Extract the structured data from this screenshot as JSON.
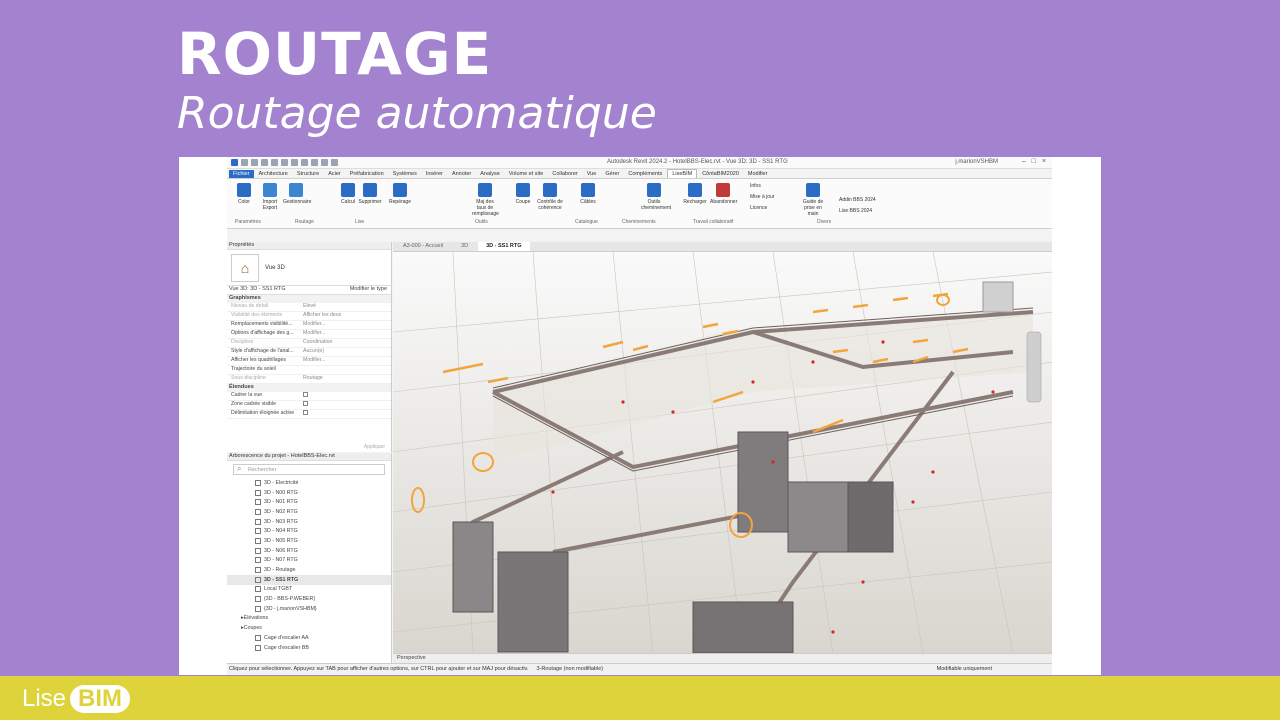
{
  "slide": {
    "title": "ROUTAGE",
    "subtitle": "Routage automatique",
    "brand_lise": "Lise",
    "brand_bim": "BIM"
  },
  "colors": {
    "background": "#a383cf",
    "footer": "#ded33b",
    "accent": "#2b6cc4",
    "routing": "#f4a43a"
  },
  "titlebar": {
    "title": "Autodesk Revit 2024.2 - HotelBBS-Elec.rvt - Vue 3D: 3D - SS1 RTG",
    "user": "j.marionVSHBM"
  },
  "tabs": [
    "Fichier",
    "Architecture",
    "Structure",
    "Acier",
    "Préfabrication",
    "Systèmes",
    "Insérer",
    "Annoter",
    "Analyse",
    "Volume et site",
    "Collaborer",
    "Vue",
    "Gérer",
    "Compléments",
    "LiseBIM",
    "CôntaBIM2020",
    "Modifier"
  ],
  "ribbon": {
    "buttons": [
      {
        "label": "Color",
        "icon": "color-icon"
      },
      {
        "label": "Import Export",
        "icon": "import-export-icon"
      },
      {
        "label": "Gestionnaire",
        "icon": "manager-icon"
      },
      {
        "label": "Calcul",
        "icon": "calc-icon"
      },
      {
        "label": "Supprimer",
        "icon": "delete-icon"
      },
      {
        "label": "Repérage",
        "icon": "marking-icon"
      },
      {
        "label": "Maj des taux de remplissage",
        "icon": "fill-rate-icon"
      },
      {
        "label": "Coupe",
        "icon": "section-icon"
      },
      {
        "label": "Contrôle de cohérence",
        "icon": "coherence-icon"
      },
      {
        "label": "Câbles",
        "icon": "cables-icon"
      },
      {
        "label": "Outils cheminement",
        "icon": "routing-tools-icon"
      },
      {
        "label": "Recharger",
        "icon": "reload-icon"
      },
      {
        "label": "Abandonner",
        "icon": "abandon-icon"
      },
      {
        "label": "Guide de prise en main",
        "icon": "guide-icon"
      }
    ],
    "small": [
      "Infos",
      "Mise à jour",
      "Licence",
      "Addin BBS 2024",
      "Lise BBS 2024"
    ],
    "groups": [
      "Paramètres",
      "Routage",
      "Lise",
      "Outils",
      "Catalogue",
      "Cheminements",
      "Travail collaboratif",
      "Divers"
    ]
  },
  "properties": {
    "title": "Propriétés",
    "type_name": "Vue 3D",
    "view_selector": "Vue 3D: 3D - SS1 RTG",
    "edit_type": "Modifier le type",
    "section_graphics": "Graphismes",
    "rows": [
      {
        "k": "Niveau de détail",
        "v": "Élevé"
      },
      {
        "k": "Visibilité des éléments",
        "v": "Afficher les deux"
      },
      {
        "k": "Remplacements visibilité...",
        "v": "Modifier..."
      },
      {
        "k": "Options d'affichage des g...",
        "v": "Modifier..."
      },
      {
        "k": "Discipline",
        "v": "Coordination"
      },
      {
        "k": "Style d'affichage de l'anal...",
        "v": "Aucun(e)"
      },
      {
        "k": "Afficher les quadrillages",
        "v": "Modifier..."
      },
      {
        "k": "Trajectoire du soleil",
        "v": ""
      },
      {
        "k": "Sous-discipline",
        "v": "Routage"
      }
    ],
    "section_extents": "Étendues",
    "extents": [
      "Cadrer la vue",
      "Zone cadrée visible",
      "Délimitation éloignée active"
    ],
    "apply": "Appliquer"
  },
  "browser": {
    "title": "Arborescence du projet - HotelBBS-Elec.rvt",
    "search": "Rechercher",
    "items": [
      "3D - Electricité",
      "3D - N00 RTG",
      "3D - N01 RTG",
      "3D - N02 RTG",
      "3D - N03 RTG",
      "3D - N04 RTG",
      "3D - N05 RTG",
      "3D - N06 RTG",
      "3D - N07 RTG",
      "3D - Routage",
      "3D - SS1 RTG",
      "Local TGBT",
      "{3D - BBS-P.WEBER}",
      "{3D - j.marionVSHBM}",
      "Élévations",
      "Coupes",
      "Cage d'escalier AA",
      "Cage d'escalier BB"
    ]
  },
  "view_tabs": [
    "A3-000 - Accueil",
    "3D",
    "3D - SS1 RTG"
  ],
  "view_bar": {
    "label": "Perspective"
  },
  "status": {
    "text": "Cliquez pour sélectionner. Appuyez sur TAB pour afficher d'autres options, sur CTRL pour ajouter et sur MAJ pour désactiv.",
    "model": "3-Routage (non modifiable)",
    "modifiable": "Modifiable uniquement"
  }
}
